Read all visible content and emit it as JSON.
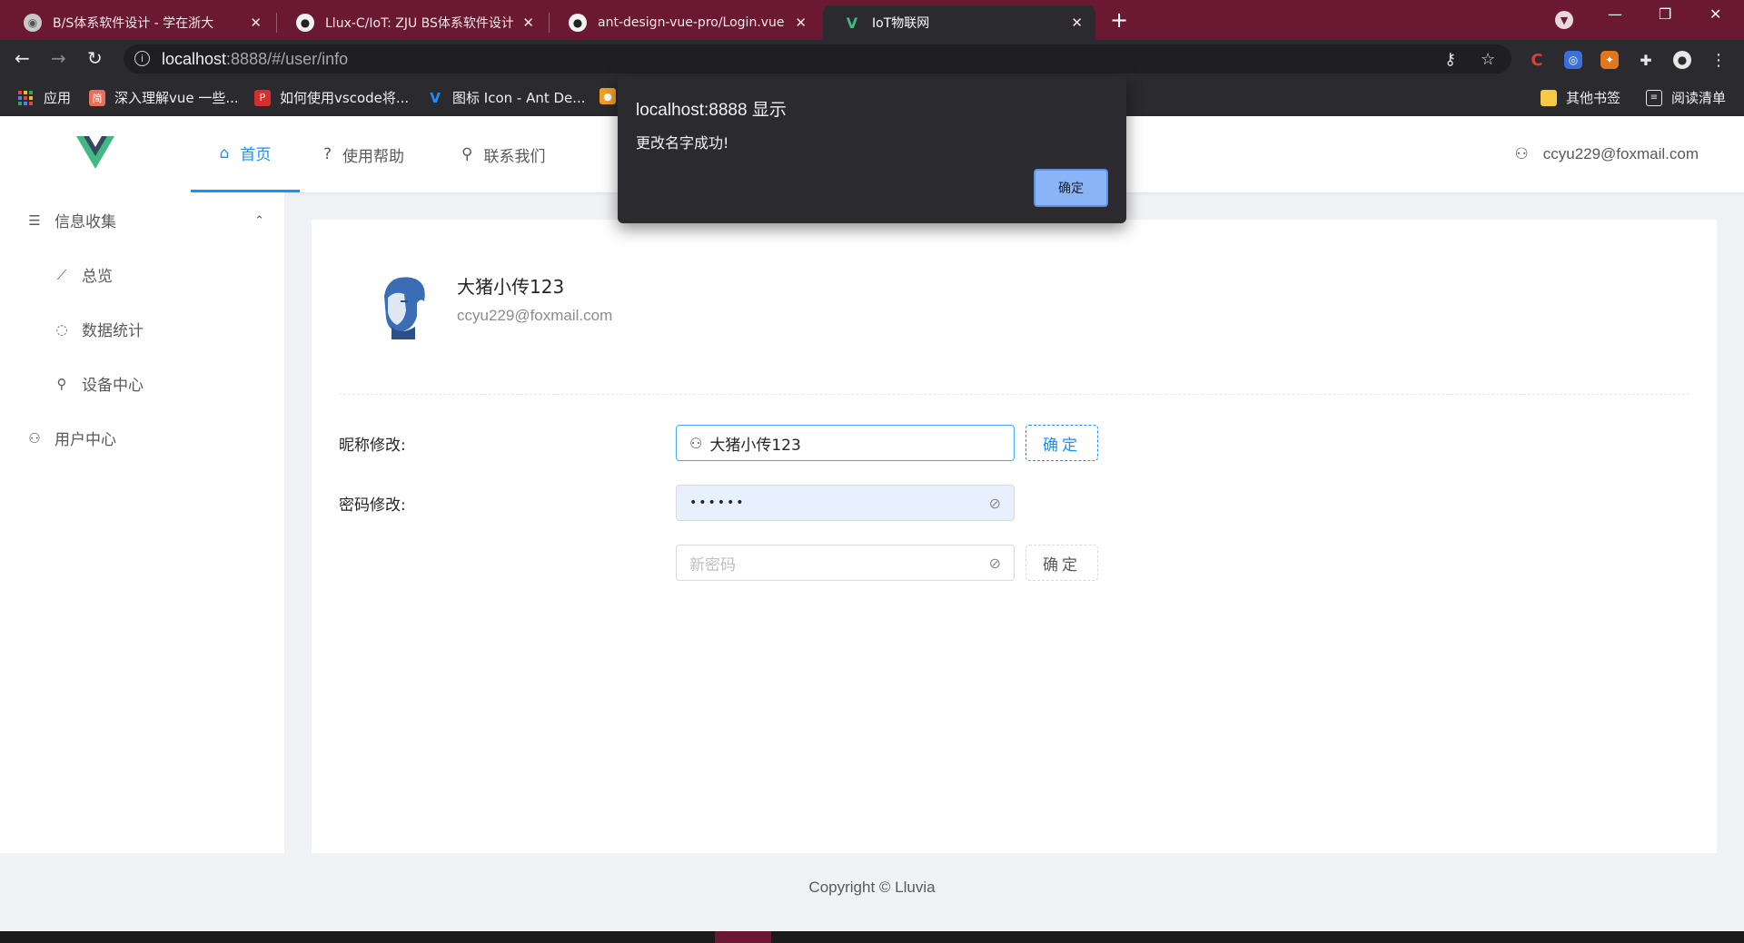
{
  "browser": {
    "tabs": [
      {
        "title": "B/S体系软件设计 - 学在浙大",
        "icon": "globe-icon"
      },
      {
        "title": "Llux-C/IoT: ZJU BS体系软件设计",
        "icon": "github-icon"
      },
      {
        "title": "ant-design-vue-pro/Login.vue",
        "icon": "github-icon"
      },
      {
        "title": "IoT物联网",
        "icon": "vue-logo-icon",
        "active": true
      }
    ],
    "url_host": "localhost",
    "url_rest": ":8888/#/user/info",
    "bookmarks": [
      {
        "label": "应用",
        "icon": "apps-grid-icon"
      },
      {
        "label": "深入理解vue 一些...",
        "icon": "jianshu-icon"
      },
      {
        "label": "如何使用vscode将...",
        "icon": "php-icon"
      },
      {
        "label": "图标 Icon - Ant De...",
        "icon": "antd-icon"
      },
      {
        "label": "其他书签",
        "icon": "folder-icon"
      },
      {
        "label": "阅读清单",
        "icon": "reading-list-icon"
      }
    ]
  },
  "header": {
    "nav": [
      {
        "label": "首页",
        "icon": "home-icon",
        "active": true
      },
      {
        "label": "使用帮助",
        "icon": "question-icon"
      },
      {
        "label": "联系我们",
        "icon": "link-icon"
      }
    ],
    "user_email": "ccyu229@foxmail.com"
  },
  "sidebar": {
    "group": {
      "label": "信息收集",
      "icon": "list-icon",
      "expanded": true
    },
    "items": [
      {
        "label": "总览",
        "icon": "line-chart-icon"
      },
      {
        "label": "数据统计",
        "icon": "message-icon"
      },
      {
        "label": "设备中心",
        "icon": "link-icon"
      }
    ],
    "user_center": {
      "label": "用户中心",
      "icon": "team-icon"
    }
  },
  "profile": {
    "name": "大猪小传123",
    "email": "ccyu229@foxmail.com"
  },
  "form": {
    "nickname_label": "昵称修改:",
    "nickname_value": "大猪小传123",
    "nickname_button": "确定",
    "password_label": "密码修改:",
    "password_value": "••••••",
    "new_password_placeholder": "新密码",
    "password_button": "确定"
  },
  "footer": {
    "copyright": "Copyright © Lluvia"
  },
  "dialog": {
    "title": "localhost:8888 显示",
    "message": "更改名字成功!",
    "ok": "确定"
  },
  "colors": {
    "primary": "#1890ff",
    "tabbar": "#6b1832",
    "chrome": "#2b2b2f",
    "dialog_button": "#8ab4f8"
  }
}
